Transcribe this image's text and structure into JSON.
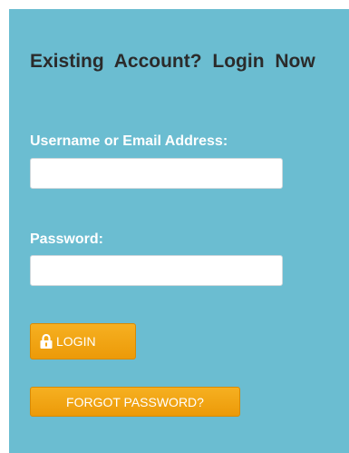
{
  "login_form": {
    "heading": "Existing Account? Login Now",
    "username_label": "Username or Email Address:",
    "username_value": "",
    "password_label": "Password:",
    "password_value": "",
    "login_button_label": "LOGIN",
    "login_icon": "lock-icon",
    "forgot_password_label": "FORGOT PASSWORD?"
  },
  "colors": {
    "panel_background": "#6bbdd1",
    "heading_text": "#2b2b2b",
    "label_text": "#ffffff",
    "button_background": "#f3a614",
    "button_text": "#ffffff"
  }
}
